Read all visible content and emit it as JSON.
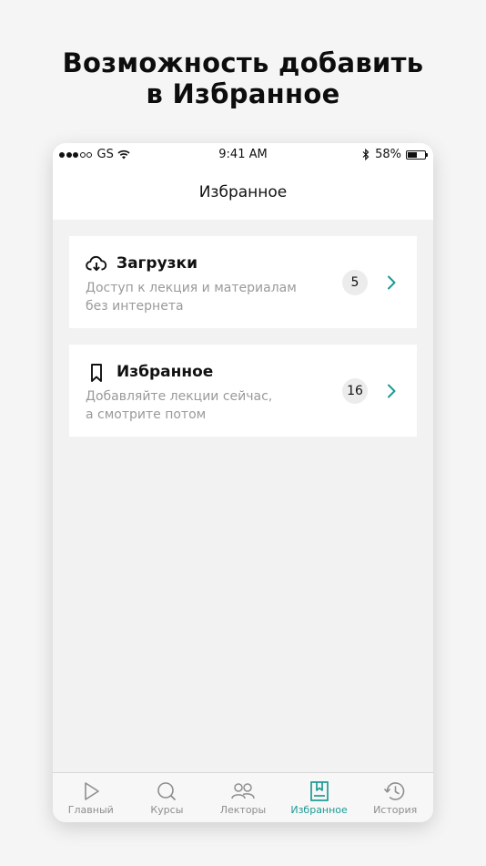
{
  "headline": {
    "line1": "Возможность добавить",
    "line2": "в Избранное"
  },
  "status_bar": {
    "carrier": "GS",
    "time": "9:41 AM",
    "battery": "58%",
    "battery_level": 0.58
  },
  "nav": {
    "title": "Избранное"
  },
  "cards": [
    {
      "icon": "cloud-download-icon",
      "title": "Загрузки",
      "desc_line1": "Доступ к лекция и материалам",
      "desc_line2": "без интернета",
      "count": "5"
    },
    {
      "icon": "bookmark-icon",
      "title": "Избранное",
      "desc_line1": "Добавляйте лекции сейчас,",
      "desc_line2": "а смотрите потом",
      "count": "16"
    }
  ],
  "tabs": [
    {
      "label": "Главный",
      "icon": "play-icon",
      "active": false
    },
    {
      "label": "Курсы",
      "icon": "search-icon",
      "active": false
    },
    {
      "label": "Лекторы",
      "icon": "people-icon",
      "active": false
    },
    {
      "label": "Избранное",
      "icon": "bookmark-box-icon",
      "active": true
    },
    {
      "label": "История",
      "icon": "history-icon",
      "active": false
    }
  ],
  "colors": {
    "accent": "#1b9a94",
    "inactive": "#8e8e8e"
  }
}
